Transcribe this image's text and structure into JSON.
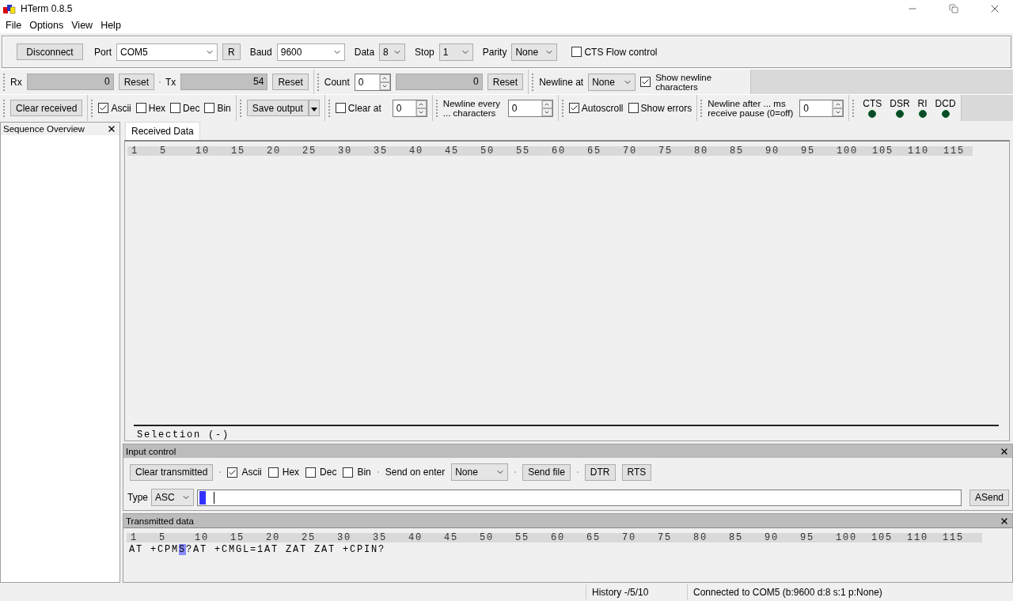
{
  "window": {
    "title": "HTerm 0.8.5"
  },
  "menu": [
    "File",
    "Options",
    "View",
    "Help"
  ],
  "connection": {
    "disconnect": "Disconnect",
    "port_label": "Port",
    "port": "COM5",
    "refresh": "R",
    "baud_label": "Baud",
    "baud": "9600",
    "data_label": "Data",
    "data": "8",
    "stop_label": "Stop",
    "stop": "1",
    "parity_label": "Parity",
    "parity": "None",
    "cts_flow": {
      "label": "CTS Flow control",
      "checked": false
    }
  },
  "counters": {
    "rx_label": "Rx",
    "rx": "0",
    "rx_reset": "Reset",
    "tx_label": "Tx",
    "tx": "54",
    "tx_reset": "Reset",
    "count_label": "Count",
    "count": "0",
    "count_value": "0",
    "count_reset": "Reset",
    "newline_at_label": "Newline at",
    "newline_at": "None",
    "show_newline": {
      "label": "Show newline characters",
      "checked": true
    }
  },
  "display": {
    "clear_received": "Clear received",
    "formats": [
      {
        "label": "Ascii",
        "checked": true
      },
      {
        "label": "Hex",
        "checked": false
      },
      {
        "label": "Dec",
        "checked": false
      },
      {
        "label": "Bin",
        "checked": false
      }
    ],
    "save_output": "Save output",
    "clear_at": {
      "label": "Clear at",
      "checked": false
    },
    "clear_at_value": "0",
    "newline_every_label": "Newline every ... characters",
    "newline_every": "0",
    "autoscroll": {
      "label": "Autoscroll",
      "checked": true
    },
    "show_errors": {
      "label": "Show errors",
      "checked": false
    },
    "newline_after_label": "Newline after ... ms receive pause (0=off)",
    "newline_after": "0",
    "leds": [
      {
        "label": "CTS",
        "on": false
      },
      {
        "label": "DSR",
        "on": false
      },
      {
        "label": "RI",
        "on": false
      },
      {
        "label": "DCD",
        "on": false
      }
    ]
  },
  "sequence_overview": {
    "title": "Sequence Overview"
  },
  "received": {
    "tab": {
      "label": "Received Data",
      "selected": true
    },
    "ruler": [
      "1",
      "5",
      "10",
      "15",
      "20",
      "25",
      "30",
      "35",
      "40",
      "45",
      "50",
      "55",
      "60",
      "65",
      "70",
      "75",
      "80",
      "85",
      "90",
      "95",
      "100",
      "105",
      "110",
      "115"
    ],
    "selection": "Selection (-)"
  },
  "input_control": {
    "title": "Input control",
    "clear_transmitted": "Clear transmitted",
    "formats": [
      {
        "label": "Ascii",
        "checked": true
      },
      {
        "label": "Hex",
        "checked": false
      },
      {
        "label": "Dec",
        "checked": false
      },
      {
        "label": "Bin",
        "checked": false
      }
    ],
    "send_on_enter_label": "Send on enter",
    "send_on_enter": "None",
    "send_file": "Send file",
    "dtr": "DTR",
    "rts": "RTS",
    "type_label": "Type",
    "type": "ASC",
    "asend": "ASend"
  },
  "transmitted": {
    "title": "Transmitted data",
    "ruler": [
      "1",
      "5",
      "10",
      "15",
      "20",
      "25",
      "30",
      "35",
      "40",
      "45",
      "50",
      "55",
      "60",
      "65",
      "70",
      "75",
      "80",
      "85",
      "90",
      "95",
      "100",
      "105",
      "110",
      "115"
    ],
    "text_before": "AT +CPM",
    "text_cursor": "S",
    "text_after": "?AT +CMGL=1AT ZAT ZAT +CPIN?"
  },
  "status_bar": {
    "history": "History -/5/10",
    "connection": "Connected to COM5 (b:9600 d:8 s:1 p:None)"
  }
}
